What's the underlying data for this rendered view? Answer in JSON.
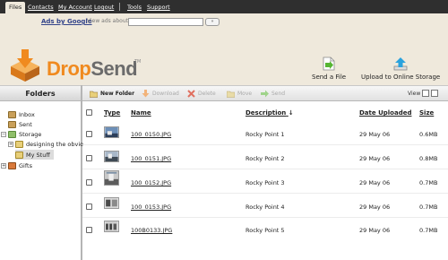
{
  "nav": {
    "items": [
      "Files",
      "Contacts",
      "My Account",
      "Logout",
      "Tools",
      "Support"
    ],
    "active": "Files"
  },
  "ads": {
    "label": "Ads by Google",
    "view_label": "View ads about:",
    "input_value": "",
    "button_glyph": "»"
  },
  "brand": {
    "drop": "Drop",
    "send": "Send",
    "tm": "TM"
  },
  "header_actions": {
    "send_file": "Send a File",
    "upload": "Upload to Online Storage"
  },
  "folders": {
    "title": "Folders",
    "items": [
      {
        "label": "Inbox"
      },
      {
        "label": "Sent"
      },
      {
        "label": "Storage"
      },
      {
        "label": "designing the obvio"
      },
      {
        "label": "My Stuff"
      },
      {
        "label": "Gifts"
      }
    ]
  },
  "toolbar": {
    "new_folder": "New Folder",
    "download": "Download",
    "delete": "Delete",
    "move": "Move",
    "send": "Send",
    "view": "View"
  },
  "table": {
    "columns": {
      "type": "Type",
      "name": "Name",
      "description": "Description",
      "sort_arrow": "↓",
      "date": "Date Uploaded",
      "size": "Size"
    },
    "rows": [
      {
        "name": "100_0150.JPG",
        "description": "Rocky Point 1",
        "date": "29 May 06",
        "size": "0.6MB"
      },
      {
        "name": "100_0151.JPG",
        "description": "Rocky Point 2",
        "date": "29 May 06",
        "size": "0.8MB"
      },
      {
        "name": "100_0152.JPG",
        "description": "Rocky Point 3",
        "date": "29 May 06",
        "size": "0.7MB"
      },
      {
        "name": "100_0153.JPG",
        "description": "Rocky Point 4",
        "date": "29 May 06",
        "size": "0.7MB"
      },
      {
        "name": "100B0133.JPG",
        "description": "Rocky Point 5",
        "date": "29 May 06",
        "size": "0.7MB"
      }
    ]
  },
  "colors": {
    "nav_bg": "#2f2f2f",
    "header_bg": "#efe9dc",
    "brand_orange": "#f08a1f",
    "brand_gray": "#6b6b6b",
    "send_arrow": "#57b534",
    "upload_arrow": "#2aa2dd"
  }
}
